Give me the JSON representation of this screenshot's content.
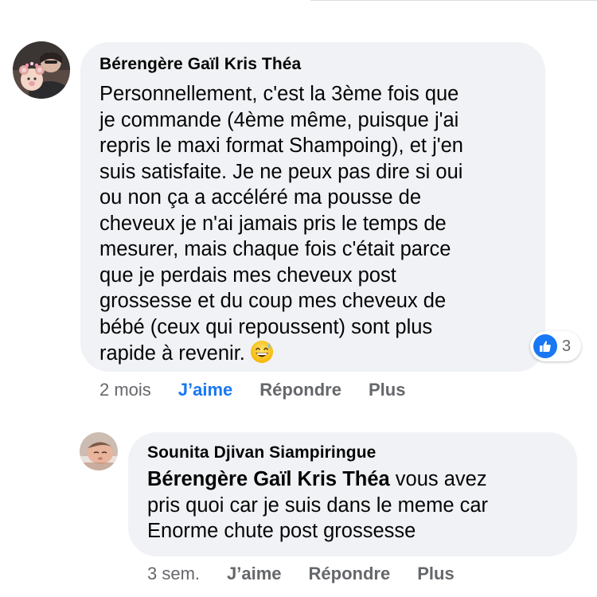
{
  "comments": [
    {
      "author": "Bérengère Gaïl Kris Théa",
      "text": "Personnellement, c'est la 3ème fois que\nje commande (4ème même, puisque j'ai\nrepris le maxi format Shampoing), et j'en\nsuis satisfaite. Je ne peux pas dire si oui\nou non ça a accéléré ma pousse de\ncheveux je n'ai jamais pris le temps de\nmesurer, mais chaque fois c'était parce\nque je perdais mes cheveux post\ngrossesse et du coup mes cheveux de\nbébé (ceux qui repoussent) sont plus\nrapide à revenir.",
      "emoji": "grinning-sweat-emoji",
      "reactions": {
        "icon": "thumbs-up-icon",
        "count": "3"
      },
      "time": "2 mois",
      "like_label": "J’aime",
      "reply_label": "Répondre",
      "more_label": "Plus",
      "like_active": true
    },
    {
      "author": "Sounita Djivan Siampiringue",
      "mention": "Bérengère Gaïl Kris Théa",
      "text": " vous avez\npris quoi car je suis dans le meme car\nEnorme chute post grossesse",
      "time": "3 sem.",
      "like_label": "J’aime",
      "reply_label": "Répondre",
      "more_label": "Plus",
      "like_active": false
    }
  ],
  "colors": {
    "bubble": "#f0f2f5",
    "secondary_text": "#65676b",
    "accent": "#1877f2"
  }
}
